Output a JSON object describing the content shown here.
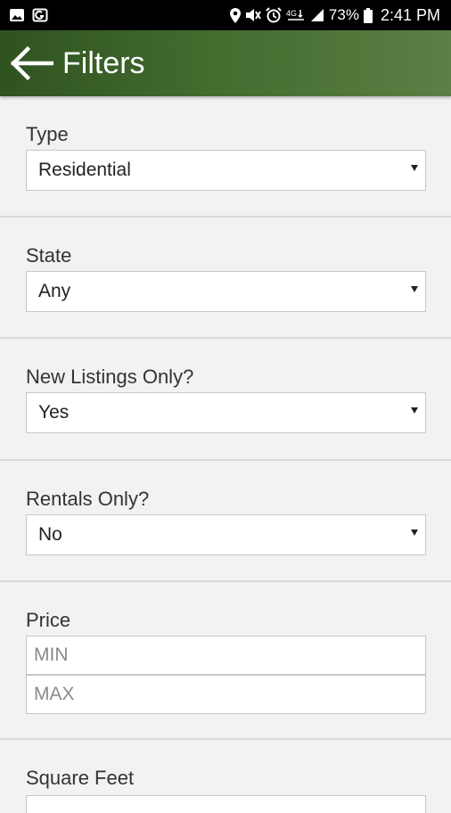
{
  "status_bar": {
    "battery": "73%",
    "clock": "2:41 PM",
    "icons_left": [
      "image-icon",
      "app-notification-icon"
    ],
    "icons_right": [
      "location-icon",
      "mute-icon",
      "alarm-icon",
      "lte-signal-icon",
      "cell-signal-icon",
      "battery-icon"
    ]
  },
  "app_bar": {
    "title": "Filters",
    "background": "#3d6229",
    "back_icon": "arrow-left-icon"
  },
  "filters": {
    "type": {
      "label": "Type",
      "value": "Residential"
    },
    "state": {
      "label": "State",
      "value": "Any"
    },
    "new_listings": {
      "label": "New Listings Only?",
      "value": "Yes"
    },
    "rentals": {
      "label": "Rentals Only?",
      "value": "No"
    },
    "price": {
      "label": "Price",
      "min_placeholder": "MIN",
      "max_placeholder": "MAX"
    },
    "square_feet": {
      "label": "Square Feet"
    }
  }
}
